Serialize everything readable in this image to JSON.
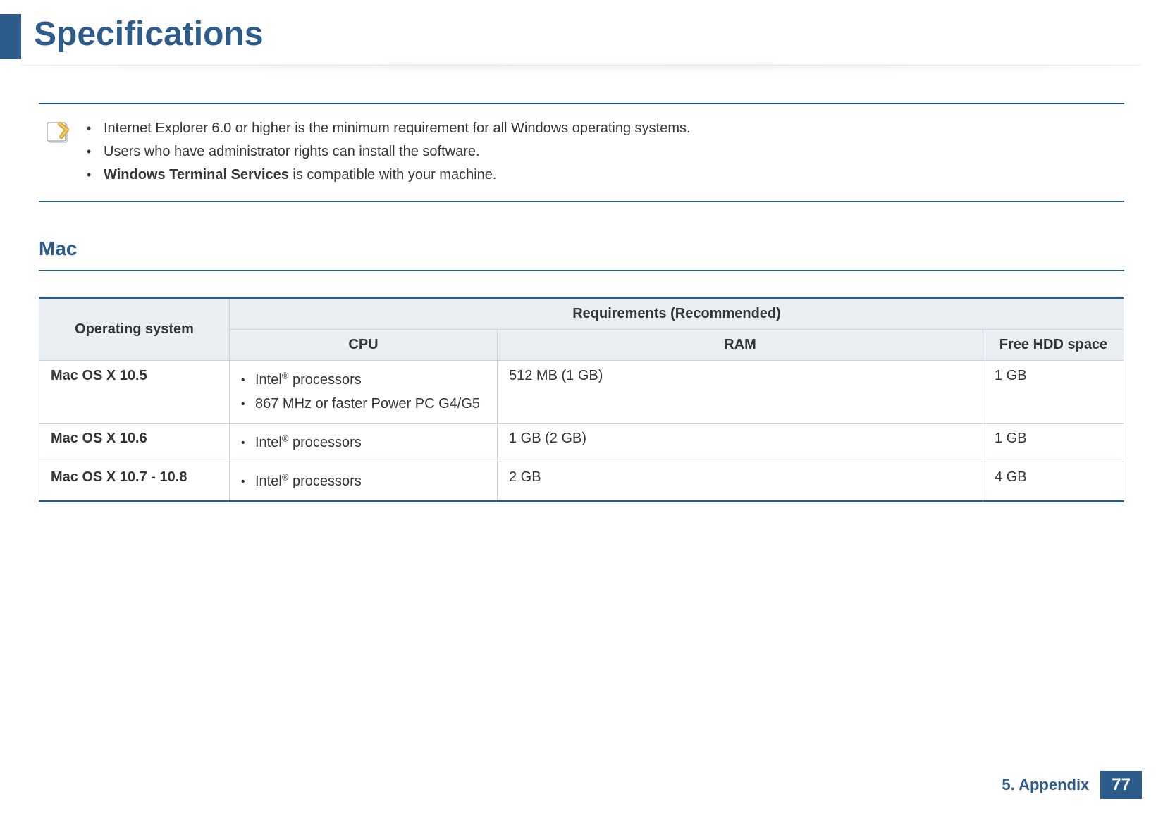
{
  "title": "Specifications",
  "note": {
    "bullet1": "Internet Explorer 6.0 or higher is the minimum requirement for all Windows operating systems.",
    "bullet2": "Users who have administrator rights can install the software.",
    "bullet3_bold": "Windows Terminal Services",
    "bullet3_rest": " is compatible with your machine."
  },
  "section_heading": "Mac",
  "table": {
    "headers": {
      "os": "Operating system",
      "req": "Requirements (Recommended)",
      "cpu": "CPU",
      "ram": "RAM",
      "hdd": "Free HDD space"
    },
    "rows": [
      {
        "os": "Mac OS X 10.5",
        "cpu1_pre": "Intel",
        "cpu1_post": " processors",
        "cpu2": "867 MHz or faster Power PC G4/G5",
        "ram": "512 MB (1 GB)",
        "hdd": "1 GB"
      },
      {
        "os": "Mac OS X 10.6",
        "cpu1_pre": "Intel",
        "cpu1_post": " processors",
        "ram": "1 GB (2 GB)",
        "hdd": "1 GB"
      },
      {
        "os": "Mac OS X 10.7 - 10.8",
        "cpu1_pre": "Intel",
        "cpu1_post": " processors",
        "ram": "2 GB",
        "hdd": "4 GB"
      }
    ]
  },
  "footer": {
    "section": "5. Appendix",
    "page": "77"
  },
  "reg_mark": "®"
}
